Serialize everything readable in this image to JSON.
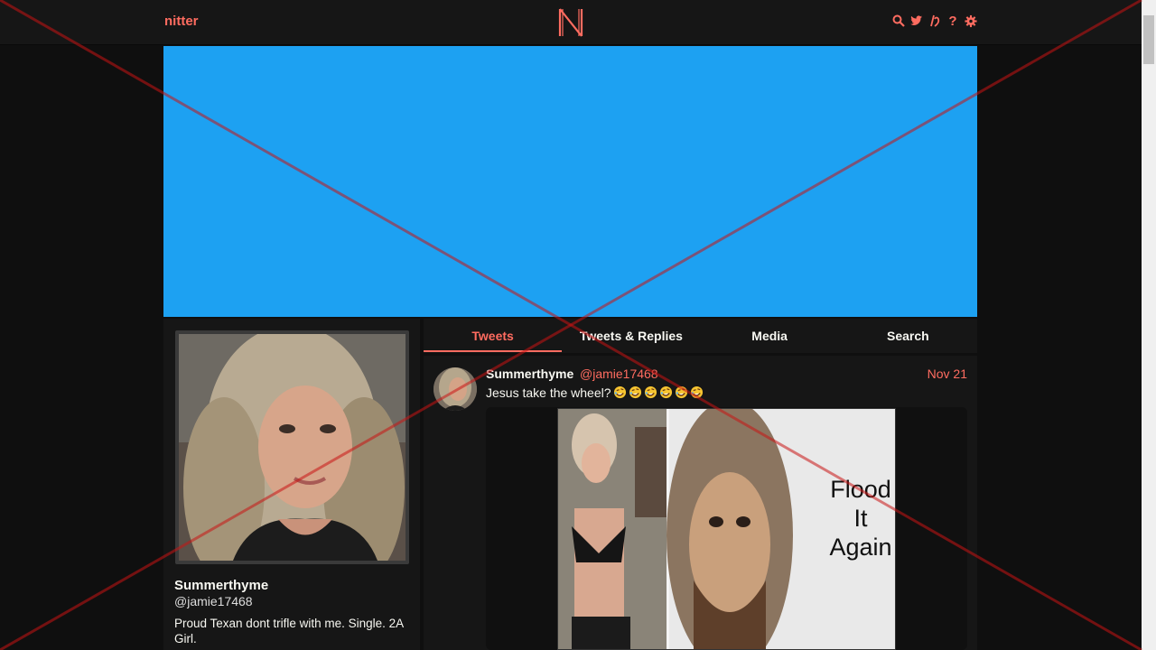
{
  "nav": {
    "brand": "nitter",
    "logo_letter": "N",
    "icons": [
      "search-icon",
      "twitter-bird-icon",
      "rss-icon",
      "help-icon",
      "gear-icon"
    ],
    "help_glyph": "?"
  },
  "colors": {
    "accent": "#ff6c60",
    "banner": "#1da1f2",
    "background": "#0f0f0f",
    "panel": "#161616"
  },
  "profile": {
    "fullname": "Summerthyme",
    "username": "@jamie17468",
    "bio": "Proud Texan dont trifle with me. Single. 2A Girl."
  },
  "tabs": [
    {
      "label": "Tweets",
      "active": true
    },
    {
      "label": "Tweets & Replies",
      "active": false
    },
    {
      "label": "Media",
      "active": false
    },
    {
      "label": "Search",
      "active": false
    }
  ],
  "tweet": {
    "fullname": "Summerthyme",
    "username": "@jamie17468",
    "date": "Nov 21",
    "text": "Jesus take the wheel?",
    "emoji_count": 6,
    "emoji_name": "rolling-on-floor-laughing-emoji",
    "media_caption": "Flood It Again",
    "media_caption_lines": [
      "Flood",
      "It",
      "Again"
    ]
  }
}
